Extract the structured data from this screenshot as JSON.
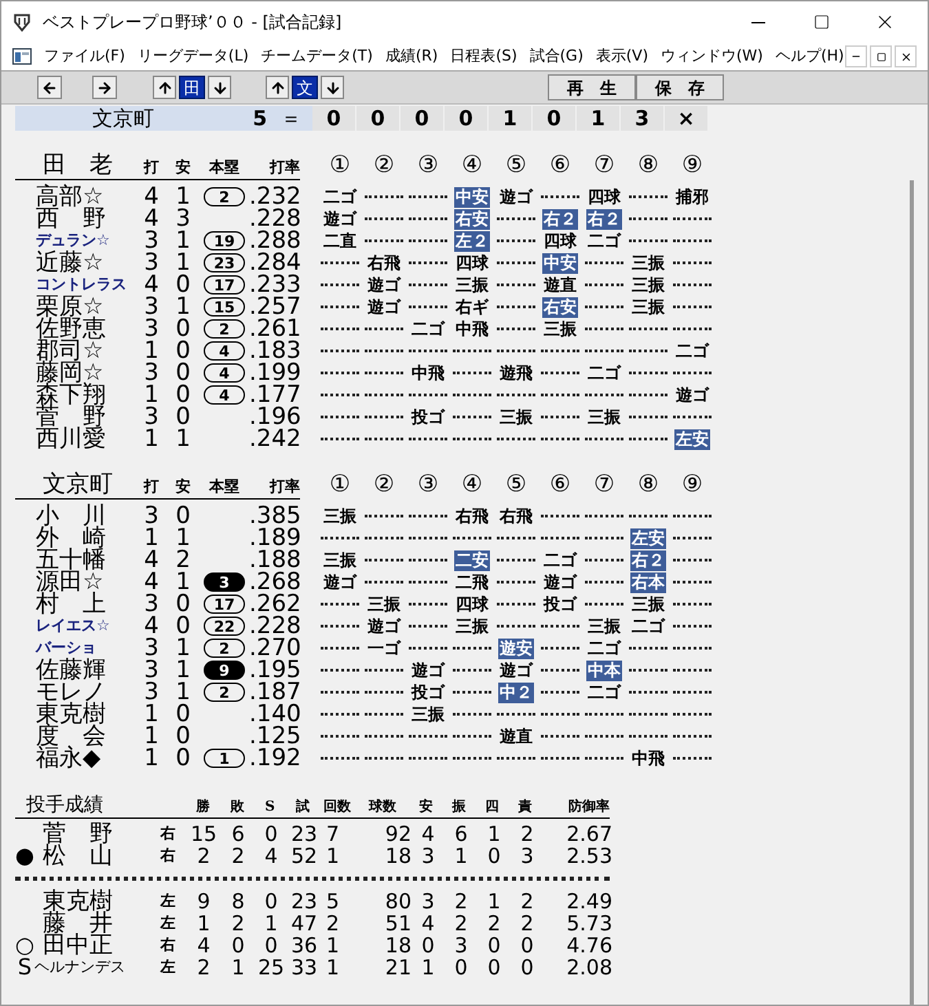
{
  "window": {
    "title": "ベストプレープロ野球’００ - [試合記録]"
  },
  "menu": [
    "ファイル(F)",
    "リーグデータ(L)",
    "チームデータ(T)",
    "成績(R)",
    "日程表(S)",
    "試合(G)",
    "表示(V)",
    "ウィンドウ(W)",
    "ヘルプ(H)"
  ],
  "toolbar": {
    "team_buttons": [
      {
        "label": "田",
        "selected": true
      },
      {
        "label": "文",
        "selected": true
      }
    ],
    "actions": [
      "再　生",
      "保　存"
    ]
  },
  "scoreline": {
    "team": "文京町",
    "total": "5",
    "equals": "＝",
    "innings": [
      "0",
      "0",
      "0",
      "0",
      "1",
      "0",
      "1",
      "3",
      "×"
    ]
  },
  "teams": [
    {
      "name": "田　老",
      "headers": [
        "打",
        "安",
        "本塁",
        "打率"
      ],
      "inning_headers": [
        "①",
        "②",
        "③",
        "④",
        "⑤",
        "⑥",
        "⑦",
        "⑧",
        "⑨"
      ],
      "batters": [
        {
          "name": "高部☆",
          "foreign": false,
          "ab": "4",
          "h": "1",
          "hr": {
            "text": "2",
            "kind": "outline"
          },
          "avg": ".232",
          "at_bats": [
            {
              "kind": "out",
              "text": "二ゴ"
            },
            {
              "kind": "none"
            },
            {
              "kind": "none"
            },
            {
              "kind": "hit",
              "text": "中安"
            },
            {
              "kind": "out",
              "text": "遊ゴ"
            },
            {
              "kind": "none"
            },
            {
              "kind": "out",
              "text": "四球"
            },
            {
              "kind": "none"
            },
            {
              "kind": "out",
              "text": "捕邪"
            }
          ]
        },
        {
          "name": "西　野",
          "foreign": false,
          "ab": "4",
          "h": "3",
          "avg": ".228",
          "at_bats": [
            {
              "kind": "out",
              "text": "遊ゴ"
            },
            {
              "kind": "none"
            },
            {
              "kind": "none"
            },
            {
              "kind": "hit",
              "text": "右安"
            },
            {
              "kind": "none"
            },
            {
              "kind": "hit",
              "text": "右２"
            },
            {
              "kind": "hit",
              "text": "右２"
            },
            {
              "kind": "none"
            },
            {
              "kind": "none"
            }
          ]
        },
        {
          "name": "デュラン☆",
          "foreign": true,
          "ab": "3",
          "h": "1",
          "hr": {
            "text": "19",
            "kind": "outline"
          },
          "avg": ".288",
          "at_bats": [
            {
              "kind": "out",
              "text": "二直"
            },
            {
              "kind": "none"
            },
            {
              "kind": "none"
            },
            {
              "kind": "hit",
              "text": "左２"
            },
            {
              "kind": "none"
            },
            {
              "kind": "out",
              "text": "四球"
            },
            {
              "kind": "out",
              "text": "二ゴ"
            },
            {
              "kind": "none"
            },
            {
              "kind": "none"
            }
          ]
        },
        {
          "name": "近藤☆",
          "foreign": false,
          "ab": "3",
          "h": "1",
          "hr": {
            "text": "23",
            "kind": "outline"
          },
          "avg": ".284",
          "at_bats": [
            {
              "kind": "none"
            },
            {
              "kind": "out",
              "text": "右飛"
            },
            {
              "kind": "none"
            },
            {
              "kind": "out",
              "text": "四球"
            },
            {
              "kind": "none"
            },
            {
              "kind": "hit",
              "text": "中安"
            },
            {
              "kind": "none"
            },
            {
              "kind": "out",
              "text": "三振"
            },
            {
              "kind": "none"
            }
          ]
        },
        {
          "name": "コントレラス",
          "foreign": true,
          "ab": "4",
          "h": "0",
          "hr": {
            "text": "17",
            "kind": "outline"
          },
          "avg": ".233",
          "at_bats": [
            {
              "kind": "none"
            },
            {
              "kind": "out",
              "text": "遊ゴ"
            },
            {
              "kind": "none"
            },
            {
              "kind": "out",
              "text": "三振"
            },
            {
              "kind": "none"
            },
            {
              "kind": "out",
              "text": "遊直"
            },
            {
              "kind": "none"
            },
            {
              "kind": "out",
              "text": "三振"
            },
            {
              "kind": "none"
            }
          ]
        },
        {
          "name": "栗原☆",
          "foreign": false,
          "ab": "3",
          "h": "1",
          "hr": {
            "text": "15",
            "kind": "outline"
          },
          "avg": ".257",
          "at_bats": [
            {
              "kind": "none"
            },
            {
              "kind": "out",
              "text": "遊ゴ"
            },
            {
              "kind": "none"
            },
            {
              "kind": "out",
              "text": "右ギ"
            },
            {
              "kind": "none"
            },
            {
              "kind": "hit",
              "text": "右安"
            },
            {
              "kind": "none"
            },
            {
              "kind": "out",
              "text": "三振"
            },
            {
              "kind": "none"
            }
          ]
        },
        {
          "name": "佐野恵",
          "foreign": false,
          "ab": "3",
          "h": "0",
          "hr": {
            "text": "2",
            "kind": "outline"
          },
          "avg": ".261",
          "at_bats": [
            {
              "kind": "none"
            },
            {
              "kind": "none"
            },
            {
              "kind": "out",
              "text": "二ゴ"
            },
            {
              "kind": "out",
              "text": "中飛"
            },
            {
              "kind": "none"
            },
            {
              "kind": "out",
              "text": "三振"
            },
            {
              "kind": "none"
            },
            {
              "kind": "none"
            },
            {
              "kind": "none"
            }
          ]
        },
        {
          "name": "郡司☆",
          "foreign": false,
          "ab": "1",
          "h": "0",
          "hr": {
            "text": "4",
            "kind": "outline"
          },
          "avg": ".183",
          "at_bats": [
            {
              "kind": "none"
            },
            {
              "kind": "none"
            },
            {
              "kind": "none"
            },
            {
              "kind": "none"
            },
            {
              "kind": "none"
            },
            {
              "kind": "none"
            },
            {
              "kind": "none"
            },
            {
              "kind": "none"
            },
            {
              "kind": "out",
              "text": "二ゴ"
            }
          ]
        },
        {
          "name": "藤岡☆",
          "foreign": false,
          "ab": "3",
          "h": "0",
          "hr": {
            "text": "4",
            "kind": "outline"
          },
          "avg": ".199",
          "at_bats": [
            {
              "kind": "none"
            },
            {
              "kind": "none"
            },
            {
              "kind": "out",
              "text": "中飛"
            },
            {
              "kind": "none"
            },
            {
              "kind": "out",
              "text": "遊飛"
            },
            {
              "kind": "none"
            },
            {
              "kind": "out",
              "text": "二ゴ"
            },
            {
              "kind": "none"
            },
            {
              "kind": "none"
            }
          ]
        },
        {
          "name": "森下翔",
          "foreign": false,
          "ab": "1",
          "h": "0",
          "hr": {
            "text": "4",
            "kind": "outline"
          },
          "avg": ".177",
          "at_bats": [
            {
              "kind": "none"
            },
            {
              "kind": "none"
            },
            {
              "kind": "none"
            },
            {
              "kind": "none"
            },
            {
              "kind": "none"
            },
            {
              "kind": "none"
            },
            {
              "kind": "none"
            },
            {
              "kind": "none"
            },
            {
              "kind": "out",
              "text": "遊ゴ"
            }
          ]
        },
        {
          "name": "菅　野",
          "foreign": false,
          "ab": "3",
          "h": "0",
          "avg": ".196",
          "at_bats": [
            {
              "kind": "none"
            },
            {
              "kind": "none"
            },
            {
              "kind": "out",
              "text": "投ゴ"
            },
            {
              "kind": "none"
            },
            {
              "kind": "out",
              "text": "三振"
            },
            {
              "kind": "none"
            },
            {
              "kind": "out",
              "text": "三振"
            },
            {
              "kind": "none"
            },
            {
              "kind": "none"
            }
          ]
        },
        {
          "name": "西川愛",
          "foreign": false,
          "ab": "1",
          "h": "1",
          "avg": ".242",
          "at_bats": [
            {
              "kind": "none"
            },
            {
              "kind": "none"
            },
            {
              "kind": "none"
            },
            {
              "kind": "none"
            },
            {
              "kind": "none"
            },
            {
              "kind": "none"
            },
            {
              "kind": "none"
            },
            {
              "kind": "none"
            },
            {
              "kind": "hit",
              "text": "左安"
            }
          ]
        }
      ]
    },
    {
      "name": "文京町",
      "headers": [
        "打",
        "安",
        "本塁",
        "打率"
      ],
      "inning_headers": [
        "①",
        "②",
        "③",
        "④",
        "⑤",
        "⑥",
        "⑦",
        "⑧",
        "⑨"
      ],
      "batters": [
        {
          "name": "小　川",
          "foreign": false,
          "ab": "3",
          "h": "0",
          "avg": ".385",
          "at_bats": [
            {
              "kind": "out",
              "text": "三振"
            },
            {
              "kind": "none"
            },
            {
              "kind": "none"
            },
            {
              "kind": "out",
              "text": "右飛"
            },
            {
              "kind": "out",
              "text": "右飛"
            },
            {
              "kind": "none"
            },
            {
              "kind": "none"
            },
            {
              "kind": "none"
            },
            {
              "kind": "none"
            }
          ]
        },
        {
          "name": "外　崎",
          "foreign": false,
          "ab": "1",
          "h": "1",
          "avg": ".189",
          "at_bats": [
            {
              "kind": "none"
            },
            {
              "kind": "none"
            },
            {
              "kind": "none"
            },
            {
              "kind": "none"
            },
            {
              "kind": "none"
            },
            {
              "kind": "none"
            },
            {
              "kind": "none"
            },
            {
              "kind": "hit",
              "text": "左安"
            },
            {
              "kind": "none"
            }
          ]
        },
        {
          "name": "五十幡",
          "foreign": false,
          "ab": "4",
          "h": "2",
          "avg": ".188",
          "at_bats": [
            {
              "kind": "out",
              "text": "三振"
            },
            {
              "kind": "none"
            },
            {
              "kind": "none"
            },
            {
              "kind": "hit",
              "text": "二安"
            },
            {
              "kind": "none"
            },
            {
              "kind": "out",
              "text": "二ゴ"
            },
            {
              "kind": "none"
            },
            {
              "kind": "hit",
              "text": "右２"
            },
            {
              "kind": "none"
            }
          ]
        },
        {
          "name": "源田☆",
          "foreign": false,
          "ab": "4",
          "h": "1",
          "hr": {
            "text": "3",
            "kind": "filled"
          },
          "avg": ".268",
          "at_bats": [
            {
              "kind": "out",
              "text": "遊ゴ"
            },
            {
              "kind": "none"
            },
            {
              "kind": "none"
            },
            {
              "kind": "out",
              "text": "二飛"
            },
            {
              "kind": "none"
            },
            {
              "kind": "out",
              "text": "遊ゴ"
            },
            {
              "kind": "none"
            },
            {
              "kind": "hit",
              "text": "右本"
            },
            {
              "kind": "none"
            }
          ]
        },
        {
          "name": "村　上",
          "foreign": false,
          "ab": "3",
          "h": "0",
          "hr": {
            "text": "17",
            "kind": "outline"
          },
          "avg": ".262",
          "at_bats": [
            {
              "kind": "none"
            },
            {
              "kind": "out",
              "text": "三振"
            },
            {
              "kind": "none"
            },
            {
              "kind": "out",
              "text": "四球"
            },
            {
              "kind": "none"
            },
            {
              "kind": "out",
              "text": "投ゴ"
            },
            {
              "kind": "none"
            },
            {
              "kind": "out",
              "text": "三振"
            },
            {
              "kind": "none"
            }
          ]
        },
        {
          "name": "レイエス☆",
          "foreign": true,
          "ab": "4",
          "h": "0",
          "hr": {
            "text": "22",
            "kind": "outline"
          },
          "avg": ".228",
          "at_bats": [
            {
              "kind": "none"
            },
            {
              "kind": "out",
              "text": "遊ゴ"
            },
            {
              "kind": "none"
            },
            {
              "kind": "out",
              "text": "三振"
            },
            {
              "kind": "none"
            },
            {
              "kind": "none"
            },
            {
              "kind": "out",
              "text": "三振"
            },
            {
              "kind": "out",
              "text": "二ゴ"
            },
            {
              "kind": "none"
            }
          ]
        },
        {
          "name": "バーショ",
          "foreign": true,
          "ab": "3",
          "h": "1",
          "hr": {
            "text": "2",
            "kind": "outline"
          },
          "avg": ".270",
          "at_bats": [
            {
              "kind": "none"
            },
            {
              "kind": "out",
              "text": "一ゴ"
            },
            {
              "kind": "none"
            },
            {
              "kind": "none"
            },
            {
              "kind": "hit",
              "text": "遊安"
            },
            {
              "kind": "none"
            },
            {
              "kind": "out",
              "text": "二ゴ"
            },
            {
              "kind": "none"
            },
            {
              "kind": "none"
            }
          ]
        },
        {
          "name": "佐藤輝",
          "foreign": false,
          "ab": "3",
          "h": "1",
          "hr": {
            "text": "9",
            "kind": "filled"
          },
          "avg": ".195",
          "at_bats": [
            {
              "kind": "none"
            },
            {
              "kind": "none"
            },
            {
              "kind": "out",
              "text": "遊ゴ"
            },
            {
              "kind": "none"
            },
            {
              "kind": "out",
              "text": "遊ゴ"
            },
            {
              "kind": "none"
            },
            {
              "kind": "hit",
              "text": "中本"
            },
            {
              "kind": "none"
            },
            {
              "kind": "none"
            }
          ]
        },
        {
          "name": "モレノ",
          "foreign": false,
          "ab": "3",
          "h": "1",
          "hr": {
            "text": "2",
            "kind": "outline"
          },
          "avg": ".187",
          "at_bats": [
            {
              "kind": "none"
            },
            {
              "kind": "none"
            },
            {
              "kind": "out",
              "text": "投ゴ"
            },
            {
              "kind": "none"
            },
            {
              "kind": "hit",
              "text": "中２"
            },
            {
              "kind": "none"
            },
            {
              "kind": "out",
              "text": "二ゴ"
            },
            {
              "kind": "none"
            },
            {
              "kind": "none"
            }
          ]
        },
        {
          "name": "東克樹",
          "foreign": false,
          "ab": "1",
          "h": "0",
          "avg": ".140",
          "at_bats": [
            {
              "kind": "none"
            },
            {
              "kind": "none"
            },
            {
              "kind": "out",
              "text": "三振"
            },
            {
              "kind": "none"
            },
            {
              "kind": "none"
            },
            {
              "kind": "none"
            },
            {
              "kind": "none"
            },
            {
              "kind": "none"
            },
            {
              "kind": "none"
            }
          ]
        },
        {
          "name": "度　会",
          "foreign": false,
          "ab": "1",
          "h": "0",
          "avg": ".125",
          "at_bats": [
            {
              "kind": "none"
            },
            {
              "kind": "none"
            },
            {
              "kind": "none"
            },
            {
              "kind": "none"
            },
            {
              "kind": "out",
              "text": "遊直"
            },
            {
              "kind": "none"
            },
            {
              "kind": "none"
            },
            {
              "kind": "none"
            },
            {
              "kind": "none"
            }
          ]
        },
        {
          "name": "福永◆",
          "foreign": false,
          "ab": "1",
          "h": "0",
          "hr": {
            "text": "1",
            "kind": "outline"
          },
          "avg": ".192",
          "at_bats": [
            {
              "kind": "none"
            },
            {
              "kind": "none"
            },
            {
              "kind": "none"
            },
            {
              "kind": "none"
            },
            {
              "kind": "none"
            },
            {
              "kind": "none"
            },
            {
              "kind": "none"
            },
            {
              "kind": "out",
              "text": "中飛"
            },
            {
              "kind": "none"
            }
          ]
        }
      ]
    }
  ],
  "pitching": {
    "title": "投手成績",
    "columns": [
      "勝",
      "敗",
      "S",
      "試",
      "回数",
      "球数",
      "安",
      "振",
      "四",
      "責",
      "防御率"
    ],
    "groups": [
      [
        {
          "name": "菅　野",
          "foreign": false,
          "hand": "右",
          "stats": [
            "15",
            "6",
            "0",
            "23",
            "7",
            "92",
            "4",
            "6",
            "1",
            "2",
            "2.67"
          ]
        },
        {
          "mark": "●",
          "name": "松　山",
          "foreign": false,
          "hand": "右",
          "stats": [
            "2",
            "2",
            "4",
            "52",
            "1",
            "18",
            "3",
            "1",
            "0",
            "3",
            "2.53"
          ]
        }
      ],
      [
        {
          "name": "東克樹",
          "foreign": false,
          "hand": "左",
          "stats": [
            "9",
            "8",
            "0",
            "23",
            "5",
            "80",
            "3",
            "2",
            "1",
            "2",
            "2.49"
          ]
        },
        {
          "name": "藤　井",
          "foreign": false,
          "hand": "左",
          "stats": [
            "1",
            "2",
            "1",
            "47",
            "2",
            "51",
            "4",
            "2",
            "2",
            "2",
            "5.73"
          ]
        },
        {
          "mark": "○",
          "name": "田中正",
          "foreign": false,
          "hand": "右",
          "stats": [
            "4",
            "0",
            "0",
            "36",
            "1",
            "18",
            "0",
            "3",
            "0",
            "0",
            "4.76"
          ]
        },
        {
          "mark": "S",
          "name": "ヘルナンデス",
          "foreign": true,
          "hand": "左",
          "stats": [
            "2",
            "1",
            "25",
            "33",
            "1",
            "21",
            "1",
            "0",
            "0",
            "0",
            "2.08"
          ]
        }
      ]
    ]
  }
}
